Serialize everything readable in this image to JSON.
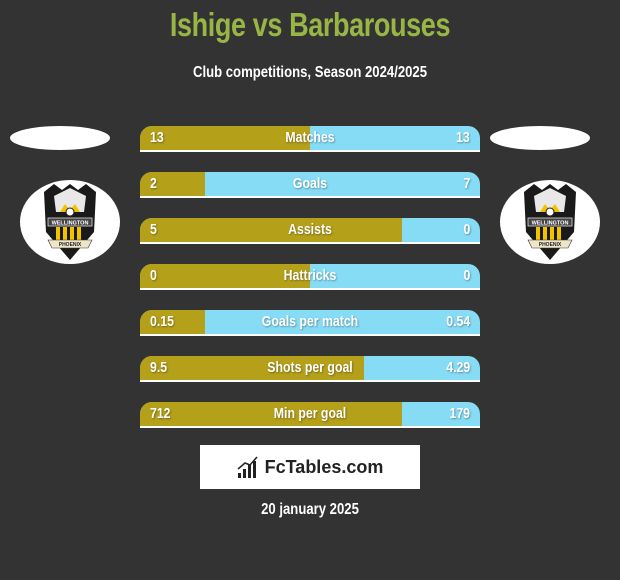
{
  "header": {
    "title": "Ishige vs Barbarouses",
    "subtitle": "Club competitions, Season 2024/2025"
  },
  "teams": {
    "left": {
      "name": "Ishige",
      "badge_icon": "wellington-phoenix-crest-icon"
    },
    "right": {
      "name": "Barbarouses",
      "badge_icon": "wellington-phoenix-crest-icon"
    }
  },
  "colors": {
    "background": "#333333",
    "title": "#98b545",
    "left_bar": "#b5a01a",
    "right_bar": "#87dcf5"
  },
  "stats": [
    {
      "label": "Matches",
      "left": "13",
      "right": "13",
      "left_share": 0.5
    },
    {
      "label": "Goals",
      "left": "2",
      "right": "7",
      "left_share": 0.19
    },
    {
      "label": "Assists",
      "left": "5",
      "right": "0",
      "left_share": 0.77
    },
    {
      "label": "Hattricks",
      "left": "0",
      "right": "0",
      "left_share": 0.5
    },
    {
      "label": "Goals per match",
      "left": "0.15",
      "right": "0.54",
      "left_share": 0.19
    },
    {
      "label": "Shots per goal",
      "left": "9.5",
      "right": "4.29",
      "left_share": 0.66
    },
    {
      "label": "Min per goal",
      "left": "712",
      "right": "179",
      "left_share": 0.77
    }
  ],
  "footer": {
    "brand": "FcTables.com",
    "date": "20 january 2025"
  }
}
